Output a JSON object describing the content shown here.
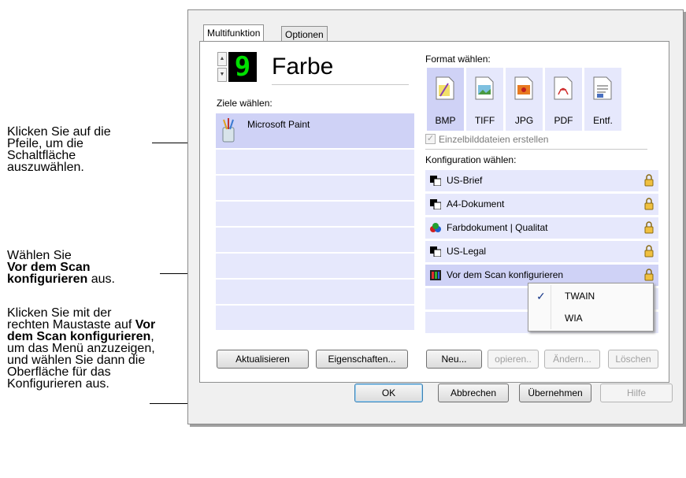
{
  "annotations": {
    "note1": "Klicken Sie auf die Pfeile, um die Schaltfläche auszuwählen.",
    "note2_pre": "Wählen Sie",
    "note2_bold": "Vor dem Scan konfigurieren",
    "note2_post": "aus.",
    "note3_pre": "Klicken Sie mit der rechten Maustaste auf",
    "note3_bold": "Vor dem Scan konfigurieren",
    "note3_post": ", um das Menü anzuzeigen, und wählen Sie dann die Oberfläche für das Konfigurieren aus."
  },
  "tabs": [
    "Multifunktion",
    "Optionen"
  ],
  "profile": {
    "number": "9",
    "name": "Farbe"
  },
  "destinations": {
    "label": "Ziele wählen:",
    "items": [
      "Microsoft Paint"
    ]
  },
  "format": {
    "label": "Format wählen:",
    "items": [
      "BMP",
      "TIFF",
      "JPG",
      "PDF",
      "Entf."
    ],
    "selected": "BMP",
    "checkbox_label": "Einzelbilddateien erstellen",
    "checkbox_checked": true
  },
  "config": {
    "label": "Konfiguration wählen:",
    "items": [
      "US-Brief",
      "A4-Dokument",
      "Farbdokument | Qualitat",
      "US-Legal",
      "Vor dem Scan konfigurieren"
    ],
    "selected": "Vor dem Scan konfigurieren"
  },
  "context_menu": {
    "items": [
      "TWAIN",
      "WIA"
    ],
    "checked": "TWAIN"
  },
  "buttons": {
    "refresh": "Aktualisieren",
    "properties": "Eigenschaften...",
    "new": "Neu...",
    "copy": "opieren..",
    "edit": "Ändern...",
    "delete": "Löschen",
    "ok": "OK",
    "cancel": "Abbrechen",
    "apply": "Übernehmen",
    "help": "Hilfe"
  },
  "colors": {
    "row_bg": "#e6e8fc",
    "row_selected": "#cfd2f6",
    "digit_green": "#00e000"
  }
}
